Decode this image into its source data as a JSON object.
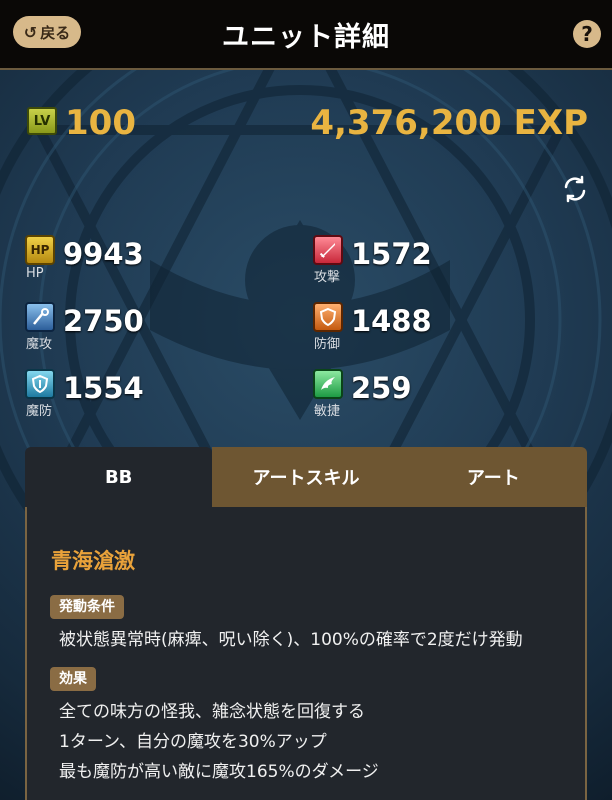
{
  "header": {
    "back_label": "戻る",
    "title": "ユニット詳細",
    "help_label": "?"
  },
  "level": {
    "badge": "LV",
    "value": "100",
    "exp": "4,376,200 EXP"
  },
  "stats": [
    {
      "key": "hp",
      "badge": "HP",
      "label": "HP",
      "value": "9943",
      "icon": "hp-icon"
    },
    {
      "key": "atk",
      "badge": "",
      "label": "攻撃",
      "value": "1572",
      "icon": "sword-icon"
    },
    {
      "key": "mag",
      "badge": "",
      "label": "魔攻",
      "value": "2750",
      "icon": "staff-icon"
    },
    {
      "key": "def",
      "badge": "",
      "label": "防御",
      "value": "1488",
      "icon": "shield-icon"
    },
    {
      "key": "res",
      "badge": "",
      "label": "魔防",
      "value": "1554",
      "icon": "magic-shield-icon"
    },
    {
      "key": "spd",
      "badge": "",
      "label": "敏捷",
      "value": "259",
      "icon": "wing-icon"
    }
  ],
  "tabs": [
    {
      "label": "BB",
      "active": true
    },
    {
      "label": "アートスキル",
      "active": false
    },
    {
      "label": "アート",
      "active": false
    }
  ],
  "skill": {
    "name": "青海滄激",
    "condition_tag": "発動条件",
    "condition": "被状態異常時(麻痺、呪い除く)、100%の確率で2度だけ発動",
    "effect_tag": "効果",
    "effects": [
      "全ての味方の怪我、雑念状態を回復する",
      "1ターン、自分の魔攻を30%アップ",
      "最も魔防が高い敵に魔攻165%のダメージ"
    ]
  },
  "colors": {
    "accent_gold": "#e9b441",
    "skill_name": "#e9a23a",
    "tab_inactive": "#6e5632",
    "panel_bg": "#22262c"
  }
}
